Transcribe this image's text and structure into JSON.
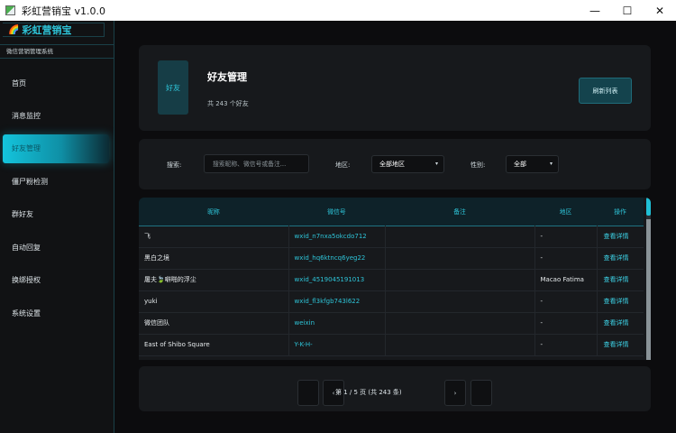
{
  "window": {
    "title": "彩虹营销宝 v1.0.0",
    "minimize": "—",
    "maximize": "☐",
    "close": "✕"
  },
  "sidebar": {
    "brand": "彩虹营销宝",
    "brand_icon": "rainbow-icon",
    "subtitle": "微信营销管理系统",
    "items": [
      {
        "label": "首页"
      },
      {
        "label": "消息监控"
      },
      {
        "label": "好友管理",
        "active": true
      },
      {
        "label": "僵尸粉检测"
      },
      {
        "label": "群好友"
      },
      {
        "label": "自动回复"
      },
      {
        "label": "换绑授权"
      },
      {
        "label": "系统设置"
      }
    ]
  },
  "header": {
    "avatar_text": "好友",
    "title": "好友管理",
    "count_text": "共 243 个好友",
    "refresh_label": "刷新列表"
  },
  "filters": {
    "search_label": "搜索:",
    "search_placeholder": "搜索昵称、微信号或备注...",
    "region_label": "地区:",
    "region_value": "全部地区",
    "gender_label": "性别:",
    "gender_value": "全部"
  },
  "table": {
    "columns": [
      "昵称",
      "微信号",
      "备注",
      "地区",
      "操作"
    ],
    "rows": [
      {
        "nickname": "飞",
        "wxid": "wxid_n7nxa5okcdo712",
        "remark": "",
        "region": "-",
        "action": "查看详情"
      },
      {
        "nickname": "黑白之境",
        "wxid": "wxid_hq6ktncq6yeg22",
        "remark": "",
        "region": "-",
        "action": "查看详情"
      },
      {
        "nickname": "屠夫🍃噼啪的浮尘",
        "wxid": "wxid_4519045191013",
        "remark": "",
        "region": "Macao Fatima",
        "action": "查看详情"
      },
      {
        "nickname": "yuki",
        "wxid": "wxid_fl3kfgb743l622",
        "remark": "",
        "region": "-",
        "action": "查看详情"
      },
      {
        "nickname": "微信团队",
        "wxid": "weixin",
        "remark": "",
        "region": "-",
        "action": "查看详情"
      },
      {
        "nickname": "East of Shibo Square",
        "wxid": "Y-K-H-",
        "remark": "",
        "region": "-",
        "action": "查看详情"
      }
    ]
  },
  "pagination": {
    "first": "",
    "prev": "‹",
    "info": "第 1 / 5 页 (共 243 条)",
    "next": "›",
    "last": ""
  },
  "colors": {
    "accent": "#2ec4d8",
    "background": "#0c0c0e",
    "panel": "#17191c"
  }
}
